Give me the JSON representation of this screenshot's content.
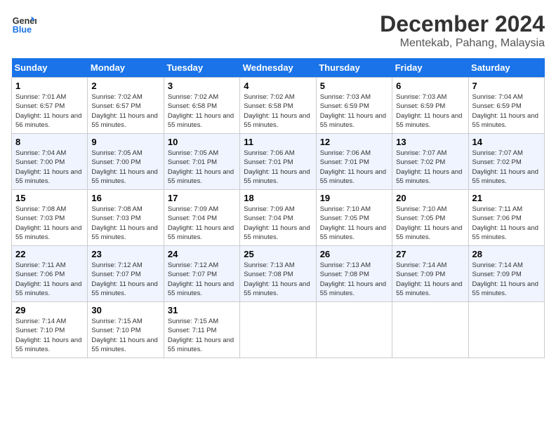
{
  "logo": {
    "line1": "General",
    "line2": "Blue"
  },
  "title": "December 2024",
  "location": "Mentekab, Pahang, Malaysia",
  "weekdays": [
    "Sunday",
    "Monday",
    "Tuesday",
    "Wednesday",
    "Thursday",
    "Friday",
    "Saturday"
  ],
  "weeks": [
    [
      {
        "day": "1",
        "sunrise": "7:01 AM",
        "sunset": "6:57 PM",
        "daylight": "11 hours and 56 minutes."
      },
      {
        "day": "2",
        "sunrise": "7:02 AM",
        "sunset": "6:57 PM",
        "daylight": "11 hours and 55 minutes."
      },
      {
        "day": "3",
        "sunrise": "7:02 AM",
        "sunset": "6:58 PM",
        "daylight": "11 hours and 55 minutes."
      },
      {
        "day": "4",
        "sunrise": "7:02 AM",
        "sunset": "6:58 PM",
        "daylight": "11 hours and 55 minutes."
      },
      {
        "day": "5",
        "sunrise": "7:03 AM",
        "sunset": "6:59 PM",
        "daylight": "11 hours and 55 minutes."
      },
      {
        "day": "6",
        "sunrise": "7:03 AM",
        "sunset": "6:59 PM",
        "daylight": "11 hours and 55 minutes."
      },
      {
        "day": "7",
        "sunrise": "7:04 AM",
        "sunset": "6:59 PM",
        "daylight": "11 hours and 55 minutes."
      }
    ],
    [
      {
        "day": "8",
        "sunrise": "7:04 AM",
        "sunset": "7:00 PM",
        "daylight": "11 hours and 55 minutes."
      },
      {
        "day": "9",
        "sunrise": "7:05 AM",
        "sunset": "7:00 PM",
        "daylight": "11 hours and 55 minutes."
      },
      {
        "day": "10",
        "sunrise": "7:05 AM",
        "sunset": "7:01 PM",
        "daylight": "11 hours and 55 minutes."
      },
      {
        "day": "11",
        "sunrise": "7:06 AM",
        "sunset": "7:01 PM",
        "daylight": "11 hours and 55 minutes."
      },
      {
        "day": "12",
        "sunrise": "7:06 AM",
        "sunset": "7:01 PM",
        "daylight": "11 hours and 55 minutes."
      },
      {
        "day": "13",
        "sunrise": "7:07 AM",
        "sunset": "7:02 PM",
        "daylight": "11 hours and 55 minutes."
      },
      {
        "day": "14",
        "sunrise": "7:07 AM",
        "sunset": "7:02 PM",
        "daylight": "11 hours and 55 minutes."
      }
    ],
    [
      {
        "day": "15",
        "sunrise": "7:08 AM",
        "sunset": "7:03 PM",
        "daylight": "11 hours and 55 minutes."
      },
      {
        "day": "16",
        "sunrise": "7:08 AM",
        "sunset": "7:03 PM",
        "daylight": "11 hours and 55 minutes."
      },
      {
        "day": "17",
        "sunrise": "7:09 AM",
        "sunset": "7:04 PM",
        "daylight": "11 hours and 55 minutes."
      },
      {
        "day": "18",
        "sunrise": "7:09 AM",
        "sunset": "7:04 PM",
        "daylight": "11 hours and 55 minutes."
      },
      {
        "day": "19",
        "sunrise": "7:10 AM",
        "sunset": "7:05 PM",
        "daylight": "11 hours and 55 minutes."
      },
      {
        "day": "20",
        "sunrise": "7:10 AM",
        "sunset": "7:05 PM",
        "daylight": "11 hours and 55 minutes."
      },
      {
        "day": "21",
        "sunrise": "7:11 AM",
        "sunset": "7:06 PM",
        "daylight": "11 hours and 55 minutes."
      }
    ],
    [
      {
        "day": "22",
        "sunrise": "7:11 AM",
        "sunset": "7:06 PM",
        "daylight": "11 hours and 55 minutes."
      },
      {
        "day": "23",
        "sunrise": "7:12 AM",
        "sunset": "7:07 PM",
        "daylight": "11 hours and 55 minutes."
      },
      {
        "day": "24",
        "sunrise": "7:12 AM",
        "sunset": "7:07 PM",
        "daylight": "11 hours and 55 minutes."
      },
      {
        "day": "25",
        "sunrise": "7:13 AM",
        "sunset": "7:08 PM",
        "daylight": "11 hours and 55 minutes."
      },
      {
        "day": "26",
        "sunrise": "7:13 AM",
        "sunset": "7:08 PM",
        "daylight": "11 hours and 55 minutes."
      },
      {
        "day": "27",
        "sunrise": "7:14 AM",
        "sunset": "7:09 PM",
        "daylight": "11 hours and 55 minutes."
      },
      {
        "day": "28",
        "sunrise": "7:14 AM",
        "sunset": "7:09 PM",
        "daylight": "11 hours and 55 minutes."
      }
    ],
    [
      {
        "day": "29",
        "sunrise": "7:14 AM",
        "sunset": "7:10 PM",
        "daylight": "11 hours and 55 minutes."
      },
      {
        "day": "30",
        "sunrise": "7:15 AM",
        "sunset": "7:10 PM",
        "daylight": "11 hours and 55 minutes."
      },
      {
        "day": "31",
        "sunrise": "7:15 AM",
        "sunset": "7:11 PM",
        "daylight": "11 hours and 55 minutes."
      },
      null,
      null,
      null,
      null
    ]
  ]
}
